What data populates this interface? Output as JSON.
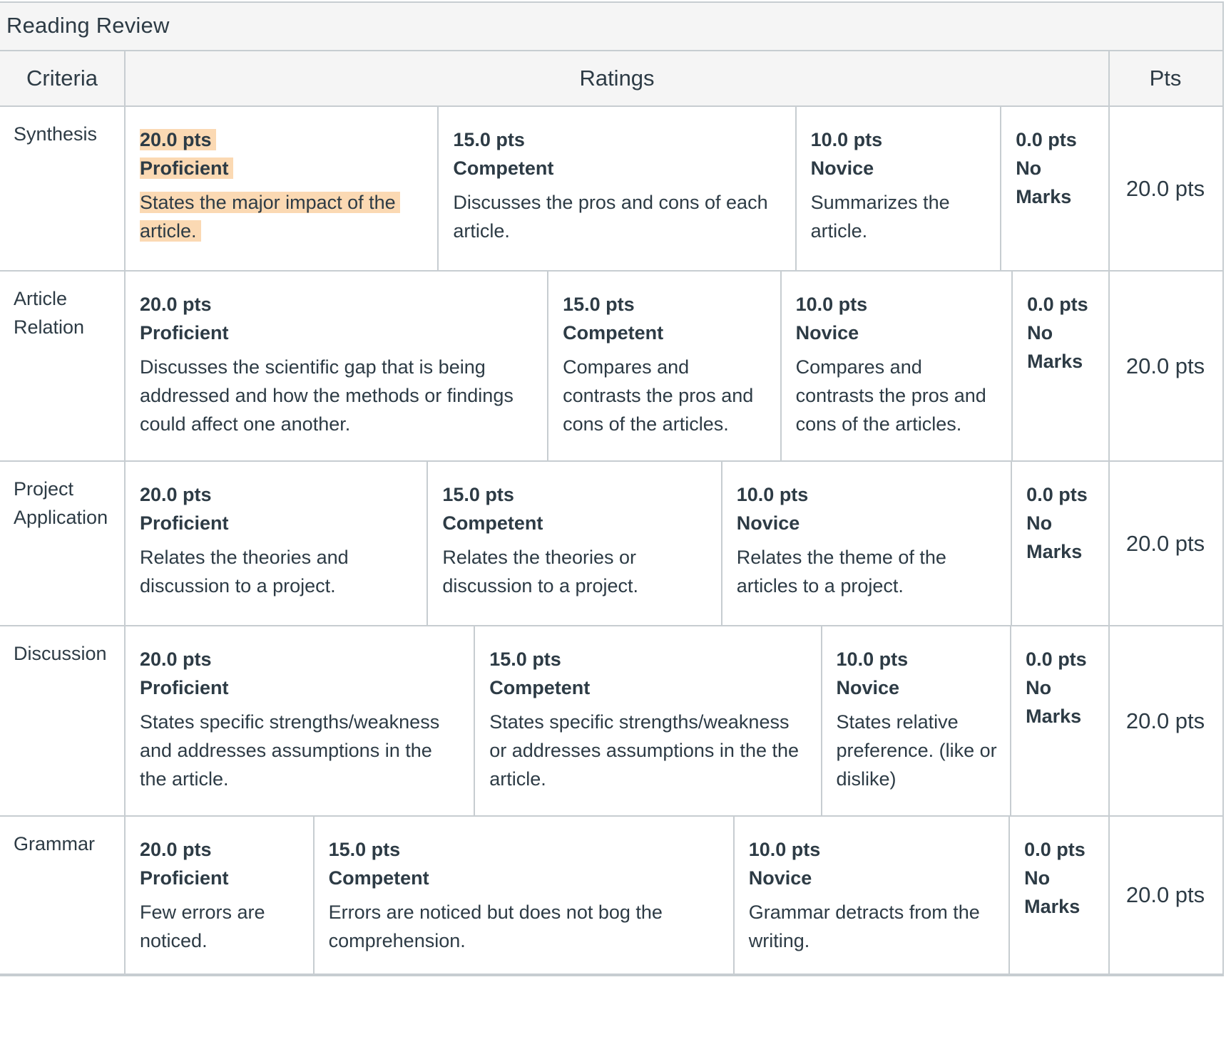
{
  "rubric": {
    "title": "Reading Review",
    "headers": {
      "criteria": "Criteria",
      "ratings": "Ratings",
      "pts": "Pts"
    },
    "criteria": [
      {
        "name": "Synthesis",
        "points": "20.0 pts",
        "ratings": [
          {
            "pts": "20.0 pts",
            "level": "Proficient",
            "desc": "States the major impact of the article.",
            "selected": true
          },
          {
            "pts": "15.0 pts",
            "level": "Competent",
            "desc": "Discusses the pros and cons of each article.",
            "selected": false
          },
          {
            "pts": "10.0 pts",
            "level": "Novice",
            "desc": "Summarizes the article.",
            "selected": false
          },
          {
            "pts": "0.0 pts",
            "level": "No Marks",
            "desc": "",
            "selected": false
          }
        ]
      },
      {
        "name": "Article Relation",
        "points": "20.0 pts",
        "ratings": [
          {
            "pts": "20.0 pts",
            "level": "Proficient",
            "desc": "Discusses the scientific gap that is being addressed and how the methods or findings could affect one another.",
            "selected": false
          },
          {
            "pts": "15.0 pts",
            "level": "Competent",
            "desc": "Compares and contrasts the pros and cons of the articles.",
            "selected": false
          },
          {
            "pts": "10.0 pts",
            "level": "Novice",
            "desc": "Compares and contrasts the pros and cons of the articles.",
            "selected": false
          },
          {
            "pts": "0.0 pts",
            "level": "No Marks",
            "desc": "",
            "selected": false
          }
        ]
      },
      {
        "name": "Project Application",
        "points": "20.0 pts",
        "ratings": [
          {
            "pts": "20.0 pts",
            "level": "Proficient",
            "desc": "Relates the theories and discussion to a project.",
            "selected": false
          },
          {
            "pts": "15.0 pts",
            "level": "Competent",
            "desc": "Relates the theories or discussion to a project.",
            "selected": false
          },
          {
            "pts": "10.0 pts",
            "level": "Novice",
            "desc": "Relates the theme of the articles to a project.",
            "selected": false
          },
          {
            "pts": "0.0 pts",
            "level": "No Marks",
            "desc": "",
            "selected": false
          }
        ]
      },
      {
        "name": "Discussion",
        "points": "20.0 pts",
        "ratings": [
          {
            "pts": "20.0 pts",
            "level": "Proficient",
            "desc": "States specific strengths/weakness and addresses assumptions in the the article.",
            "selected": false
          },
          {
            "pts": "15.0 pts",
            "level": "Competent",
            "desc": "States specific strengths/weakness or addresses assumptions in the the article.",
            "selected": false
          },
          {
            "pts": "10.0 pts",
            "level": "Novice",
            "desc": "States relative preference. (like or dislike)",
            "selected": false
          },
          {
            "pts": "0.0 pts",
            "level": "No Marks",
            "desc": "",
            "selected": false
          }
        ]
      },
      {
        "name": "Grammar",
        "points": "20.0 pts",
        "ratings": [
          {
            "pts": "20.0 pts",
            "level": "Proficient",
            "desc": "Few errors are noticed.",
            "selected": false
          },
          {
            "pts": "15.0 pts",
            "level": "Competent",
            "desc": "Errors are noticed but does not bog the comprehension.",
            "selected": false
          },
          {
            "pts": "10.0 pts",
            "level": "Novice",
            "desc": "Grammar detracts from the writing.",
            "selected": false
          },
          {
            "pts": "0.0 pts",
            "level": "No Marks",
            "desc": "",
            "selected": false
          }
        ]
      }
    ]
  }
}
